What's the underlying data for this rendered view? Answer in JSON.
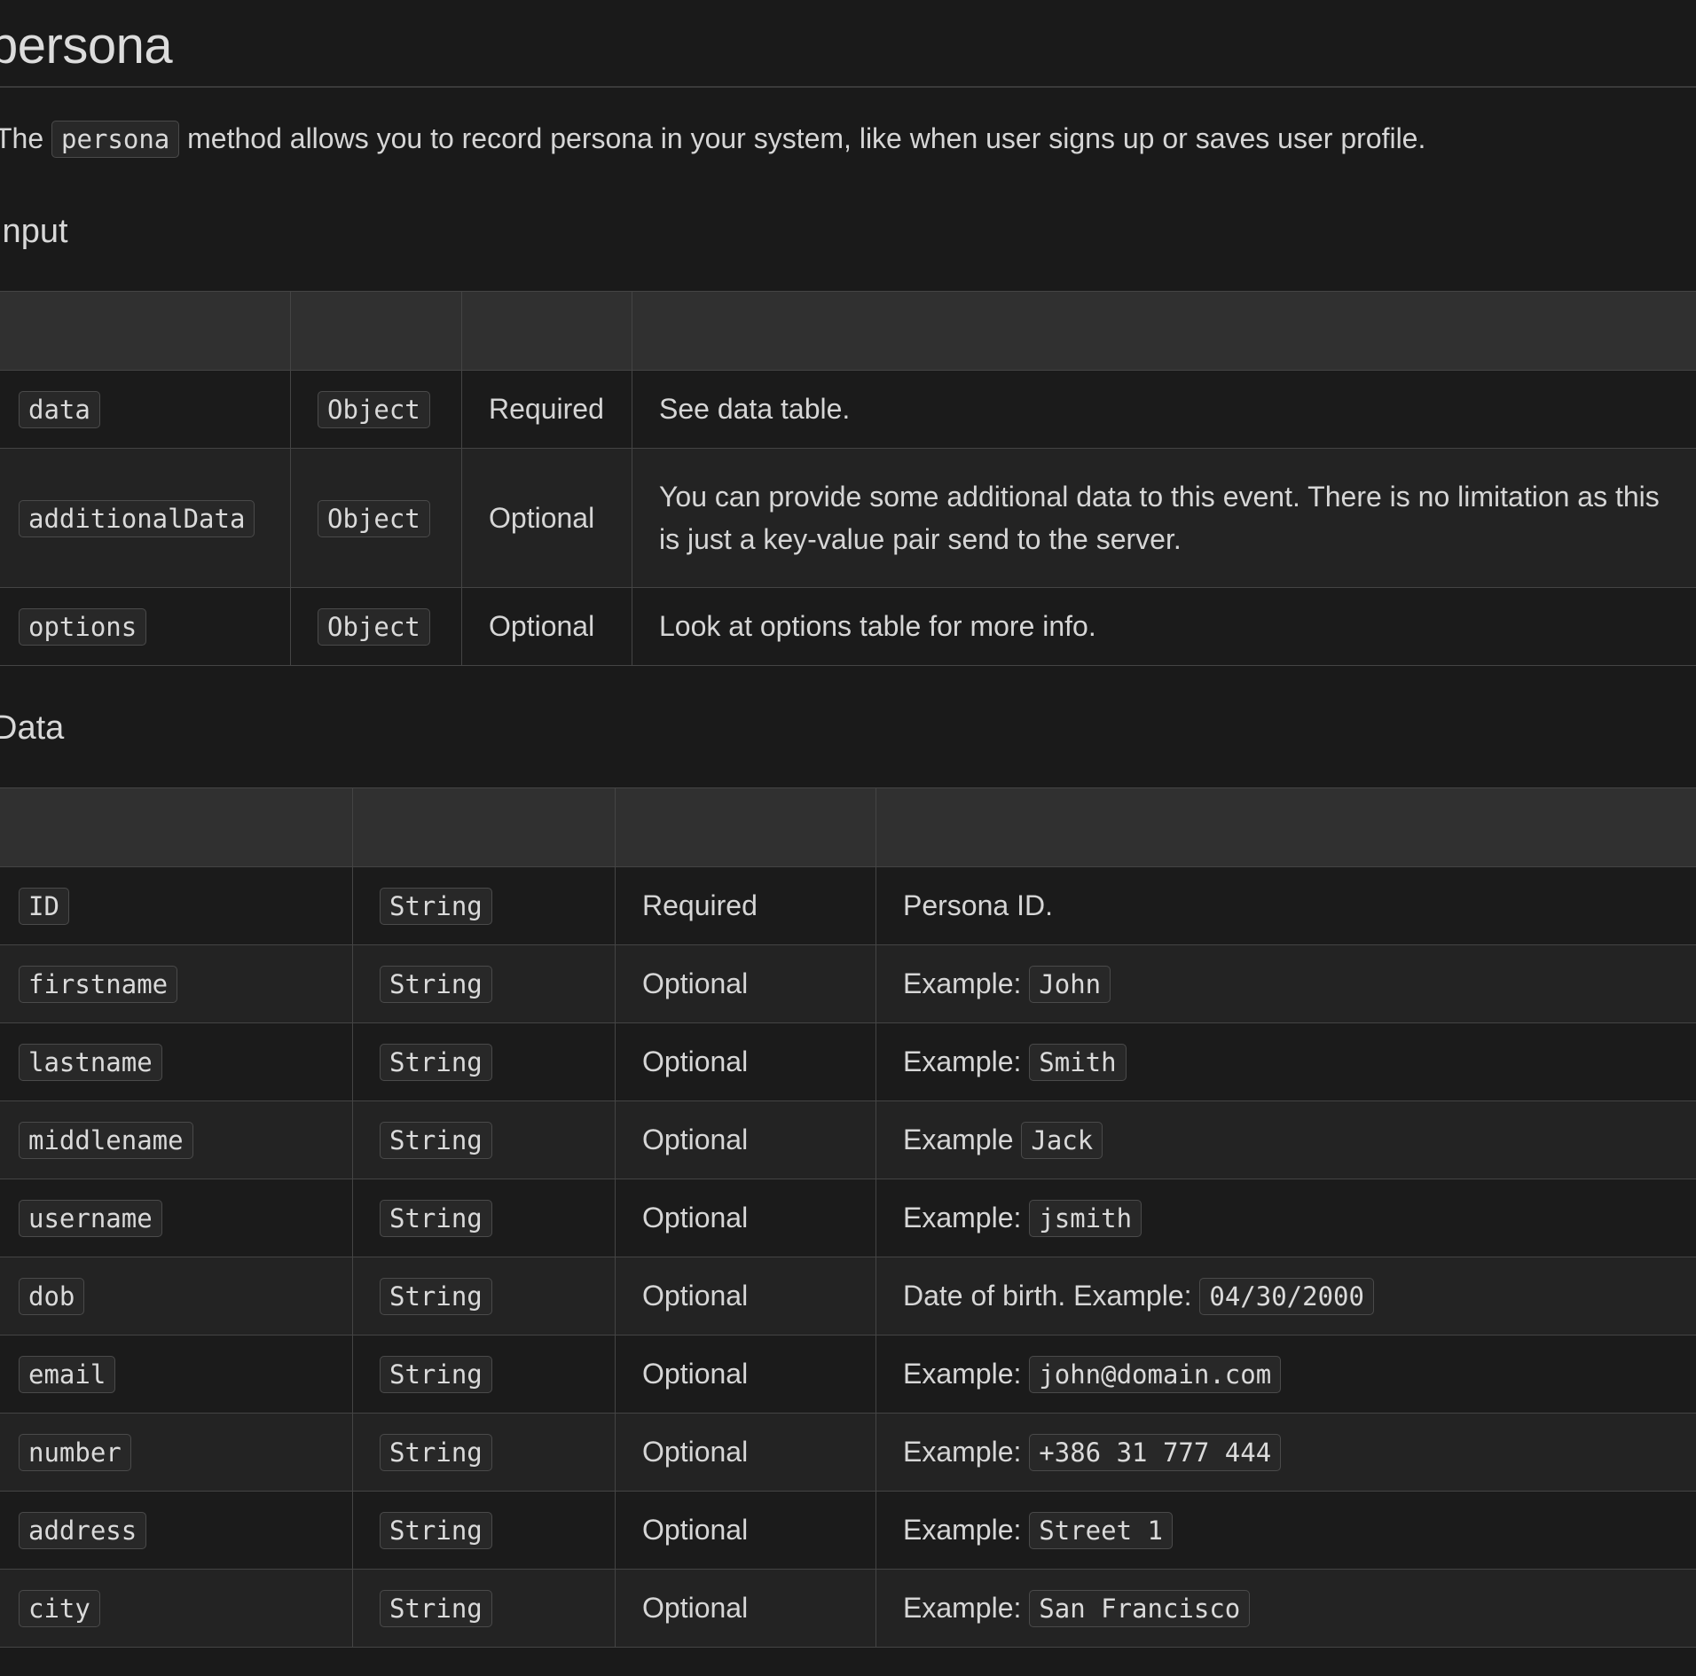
{
  "page": {
    "title": "persona",
    "intro_prefix": "The",
    "intro_code": "persona",
    "intro_suffix": "method allows you to record persona in your system, like when user signs up or saves user profile."
  },
  "input_section": {
    "heading": "Input",
    "columns": [
      "",
      "",
      "",
      ""
    ],
    "rows": [
      {
        "name": "data",
        "type": "Object",
        "req": "Required",
        "desc": "See data table."
      },
      {
        "name": "additionalData",
        "type": "Object",
        "req": "Optional",
        "desc": "You can provide some additional data to this event. There is no limitation as this is just a key-value pair send to the server."
      },
      {
        "name": "options",
        "type": "Object",
        "req": "Optional",
        "desc": "Look at options table for more info."
      }
    ]
  },
  "data_section": {
    "heading": "Data",
    "columns": [
      "",
      "",
      "",
      ""
    ],
    "rows": [
      {
        "name": "ID",
        "type": "String",
        "req": "Required",
        "desc": "Persona ID.",
        "example": ""
      },
      {
        "name": "firstname",
        "type": "String",
        "req": "Optional",
        "desc": "Example:",
        "example": "John"
      },
      {
        "name": "lastname",
        "type": "String",
        "req": "Optional",
        "desc": "Example:",
        "example": "Smith"
      },
      {
        "name": "middlename",
        "type": "String",
        "req": "Optional",
        "desc": "Example",
        "example": "Jack"
      },
      {
        "name": "username",
        "type": "String",
        "req": "Optional",
        "desc": "Example:",
        "example": "jsmith"
      },
      {
        "name": "dob",
        "type": "String",
        "req": "Optional",
        "desc": "Date of birth. Example:",
        "example": "04/30/2000"
      },
      {
        "name": "email",
        "type": "String",
        "req": "Optional",
        "desc": "Example:",
        "example": "john@domain.com"
      },
      {
        "name": "number",
        "type": "String",
        "req": "Optional",
        "desc": "Example:",
        "example": "+386 31 777 444"
      },
      {
        "name": "address",
        "type": "String",
        "req": "Optional",
        "desc": "Example:",
        "example": "Street 1"
      },
      {
        "name": "city",
        "type": "String",
        "req": "Optional",
        "desc": "Example:",
        "example": "San Francisco"
      }
    ]
  }
}
